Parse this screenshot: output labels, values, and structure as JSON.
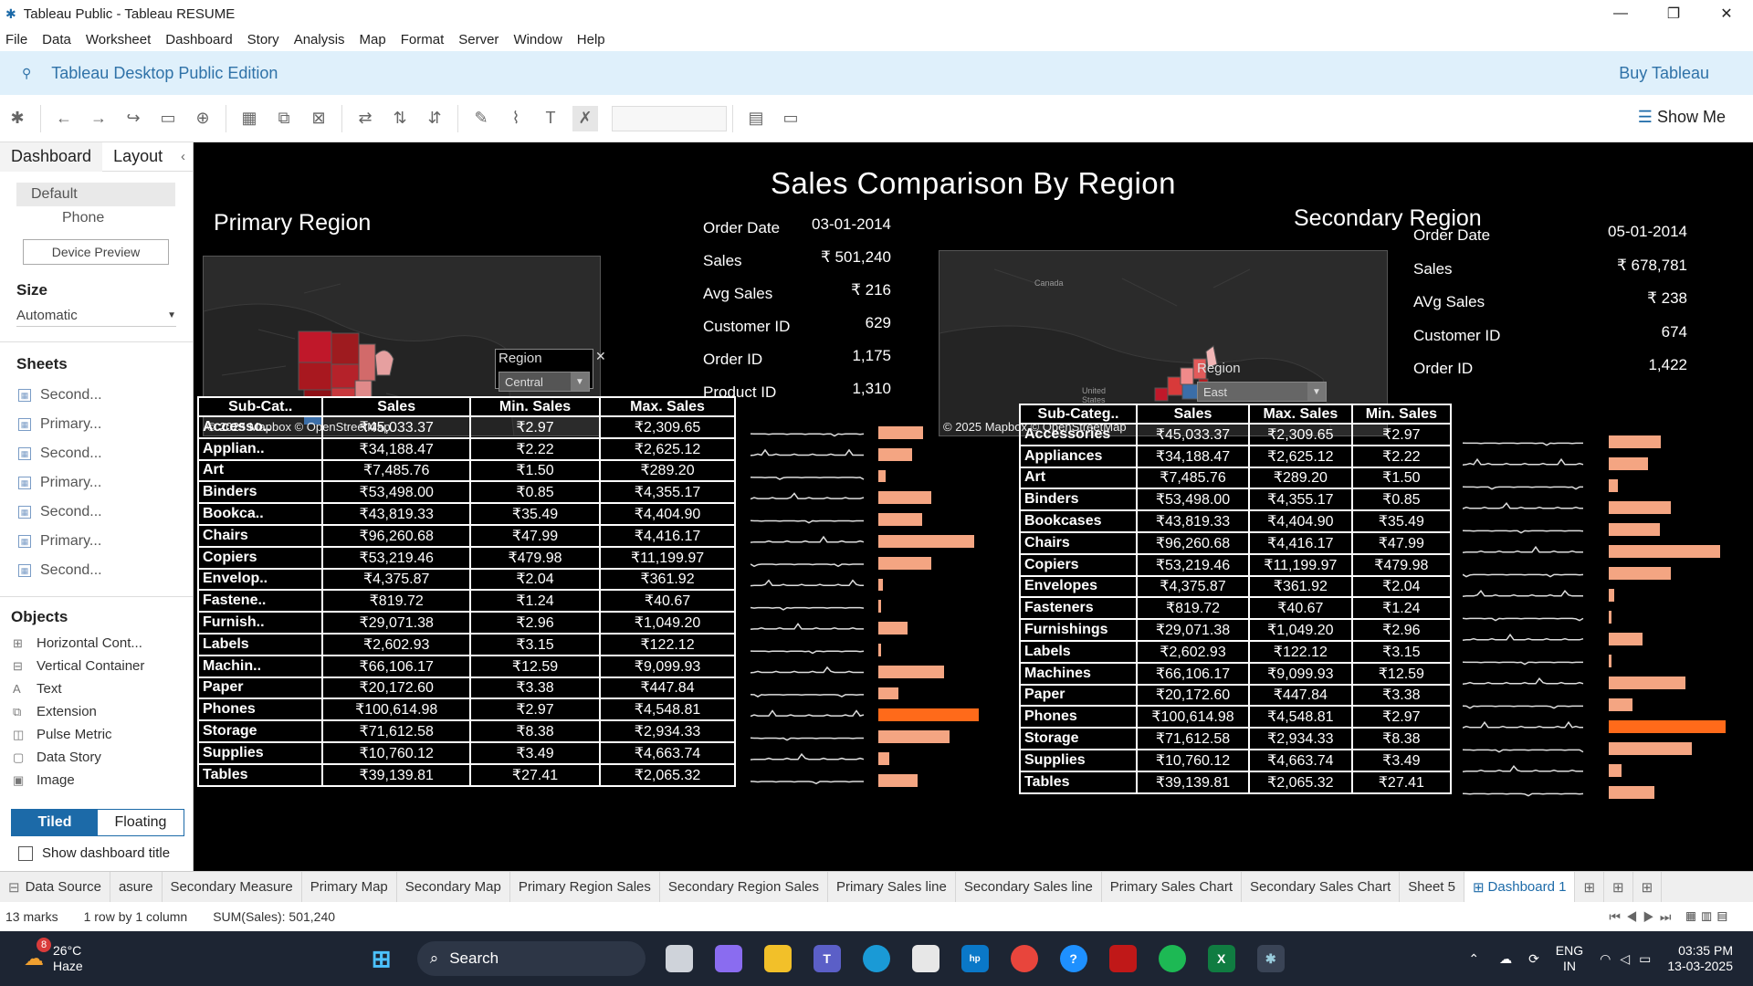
{
  "window": {
    "title": "Tableau Public - Tableau RESUME"
  },
  "menu": [
    "File",
    "Data",
    "Worksheet",
    "Dashboard",
    "Story",
    "Analysis",
    "Map",
    "Format",
    "Server",
    "Window",
    "Help"
  ],
  "edition": {
    "label": "Tableau Desktop Public Edition",
    "buy": "Buy Tableau"
  },
  "toolbar": {
    "show_me": "Show Me"
  },
  "left": {
    "tab_dashboard": "Dashboard",
    "tab_layout": "Layout",
    "device_default": "Default",
    "device_phone": "Phone",
    "device_preview": "Device Preview",
    "size_title": "Size",
    "size_value": "Automatic",
    "sheets_title": "Sheets",
    "sheets": [
      "Second...",
      "Primary...",
      "Second...",
      "Primary...",
      "Second...",
      "Primary...",
      "Second..."
    ],
    "objects_title": "Objects",
    "objects": [
      {
        "icon": "horizontal-container-icon",
        "glyph": "⊞",
        "label": "Horizontal Cont..."
      },
      {
        "icon": "vertical-container-icon",
        "glyph": "⊟",
        "label": "Vertical Container"
      },
      {
        "icon": "text-icon",
        "glyph": "A",
        "label": "Text"
      },
      {
        "icon": "extension-icon",
        "glyph": "⧉",
        "label": "Extension"
      },
      {
        "icon": "pulse-metric-icon",
        "glyph": "◫",
        "label": "Pulse Metric"
      },
      {
        "icon": "data-story-icon",
        "glyph": "▢",
        "label": "Data Story"
      },
      {
        "icon": "image-icon",
        "glyph": "▣",
        "label": "Image"
      }
    ],
    "tiled": "Tiled",
    "floating": "Floating",
    "show_title": "Show dashboard title"
  },
  "dashboard": {
    "title": "Sales Comparison By Region",
    "primary": {
      "title": "Primary Region",
      "map_credit": "© 2025 Mapbox © OpenStreetMap",
      "region_label": "Region",
      "region_value": "Central",
      "kpis": [
        {
          "k": "Order Date",
          "v": "03-01-2014"
        },
        {
          "k": "Sales",
          "v": "₹ 501,240"
        },
        {
          "k": "Avg Sales",
          "v": "₹ 216"
        },
        {
          "k": "Customer ID",
          "v": "629"
        },
        {
          "k": "Order ID",
          "v": "1,175"
        },
        {
          "k": "Product ID",
          "v": "1,310"
        }
      ],
      "headers": [
        "Sub-Cat..",
        "Sales",
        "Min. Sales",
        "Max. Sales"
      ],
      "rows": [
        [
          "Accesso..",
          "₹45,033.37",
          "₹2.97",
          "₹2,309.65"
        ],
        [
          "Applian..",
          "₹34,188.47",
          "₹2.22",
          "₹2,625.12"
        ],
        [
          "Art",
          "₹7,485.76",
          "₹1.50",
          "₹289.20"
        ],
        [
          "Binders",
          "₹53,498.00",
          "₹0.85",
          "₹4,355.17"
        ],
        [
          "Bookca..",
          "₹43,819.33",
          "₹35.49",
          "₹4,404.90"
        ],
        [
          "Chairs",
          "₹96,260.68",
          "₹47.99",
          "₹4,416.17"
        ],
        [
          "Copiers",
          "₹53,219.46",
          "₹479.98",
          "₹11,199.97"
        ],
        [
          "Envelop..",
          "₹4,375.87",
          "₹2.04",
          "₹361.92"
        ],
        [
          "Fastene..",
          "₹819.72",
          "₹1.24",
          "₹40.67"
        ],
        [
          "Furnish..",
          "₹29,071.38",
          "₹2.96",
          "₹1,049.20"
        ],
        [
          "Labels",
          "₹2,602.93",
          "₹3.15",
          "₹122.12"
        ],
        [
          "Machin..",
          "₹66,106.17",
          "₹12.59",
          "₹9,099.93"
        ],
        [
          "Paper",
          "₹20,172.60",
          "₹3.38",
          "₹447.84"
        ],
        [
          "Phones",
          "₹100,614.98",
          "₹2.97",
          "₹4,548.81"
        ],
        [
          "Storage",
          "₹71,612.58",
          "₹8.38",
          "₹2,934.33"
        ],
        [
          "Supplies",
          "₹10,760.12",
          "₹3.49",
          "₹4,663.74"
        ],
        [
          "Tables",
          "₹39,139.81",
          "₹27.41",
          "₹2,065.32"
        ]
      ],
      "bar_values": [
        45033.37,
        34188.47,
        7485.76,
        53498.0,
        43819.33,
        96260.68,
        53219.46,
        4375.87,
        819.72,
        29071.38,
        2602.93,
        66106.17,
        20172.6,
        100614.98,
        71612.58,
        10760.12,
        39139.81
      ]
    },
    "secondary": {
      "title": "Secondary Region",
      "map_credit": "© 2025 Mapbox © OpenStreetMap",
      "map_labels": [
        "Canada",
        "United States"
      ],
      "region_label": "Region",
      "region_value": "East",
      "kpis": [
        {
          "k": "Order Date",
          "v": "05-01-2014"
        },
        {
          "k": "Sales",
          "v": "₹ 678,781"
        },
        {
          "k": "AVg Sales",
          "v": "₹ 238"
        },
        {
          "k": "Customer ID",
          "v": "674"
        },
        {
          "k": "Order ID",
          "v": "1,422"
        }
      ],
      "headers": [
        "Sub-Categ..",
        "Sales",
        "Max. Sales",
        "Min. Sales"
      ],
      "rows": [
        [
          "Accessories",
          "₹45,033.37",
          "₹2,309.65",
          "₹2.97"
        ],
        [
          "Appliances",
          "₹34,188.47",
          "₹2,625.12",
          "₹2.22"
        ],
        [
          "Art",
          "₹7,485.76",
          "₹289.20",
          "₹1.50"
        ],
        [
          "Binders",
          "₹53,498.00",
          "₹4,355.17",
          "₹0.85"
        ],
        [
          "Bookcases",
          "₹43,819.33",
          "₹4,404.90",
          "₹35.49"
        ],
        [
          "Chairs",
          "₹96,260.68",
          "₹4,416.17",
          "₹47.99"
        ],
        [
          "Copiers",
          "₹53,219.46",
          "₹11,199.97",
          "₹479.98"
        ],
        [
          "Envelopes",
          "₹4,375.87",
          "₹361.92",
          "₹2.04"
        ],
        [
          "Fasteners",
          "₹819.72",
          "₹40.67",
          "₹1.24"
        ],
        [
          "Furnishings",
          "₹29,071.38",
          "₹1,049.20",
          "₹2.96"
        ],
        [
          "Labels",
          "₹2,602.93",
          "₹122.12",
          "₹3.15"
        ],
        [
          "Machines",
          "₹66,106.17",
          "₹9,099.93",
          "₹12.59"
        ],
        [
          "Paper",
          "₹20,172.60",
          "₹447.84",
          "₹3.38"
        ],
        [
          "Phones",
          "₹100,614.98",
          "₹4,548.81",
          "₹2.97"
        ],
        [
          "Storage",
          "₹71,612.58",
          "₹2,934.33",
          "₹8.38"
        ],
        [
          "Supplies",
          "₹10,760.12",
          "₹4,663.74",
          "₹3.49"
        ],
        [
          "Tables",
          "₹39,139.81",
          "₹2,065.32",
          "₹27.41"
        ]
      ],
      "bar_values": [
        45033.37,
        34188.47,
        7485.76,
        53498.0,
        43819.33,
        96260.68,
        53219.46,
        4375.87,
        819.72,
        29071.38,
        2602.93,
        66106.17,
        20172.6,
        100614.98,
        71612.58,
        10760.12,
        39139.81
      ]
    },
    "bar_color": "#f4a582",
    "bar_highlight_color": "#ff6a1a"
  },
  "tabs": {
    "data_source": "Data Source",
    "list": [
      "asure",
      "Secondary Measure",
      "Primary Map",
      "Secondary Map",
      "Primary Region Sales",
      "Secondary  Region Sales",
      "Primary Sales line",
      "Secondary  Sales line",
      "Primary Sales Chart",
      "Secondary Sales Chart",
      "Sheet 5",
      "Dashboard 1"
    ]
  },
  "status": {
    "marks": "13 marks",
    "rows": "1 row by 1 column",
    "sum": "SUM(Sales): 501,240"
  },
  "taskbar": {
    "temp": "26°C",
    "weather": "Haze",
    "weather_badge": "8",
    "search": "Search",
    "lang1": "ENG",
    "lang2": "IN",
    "time": "03:35 PM",
    "date": "13-03-2025"
  }
}
